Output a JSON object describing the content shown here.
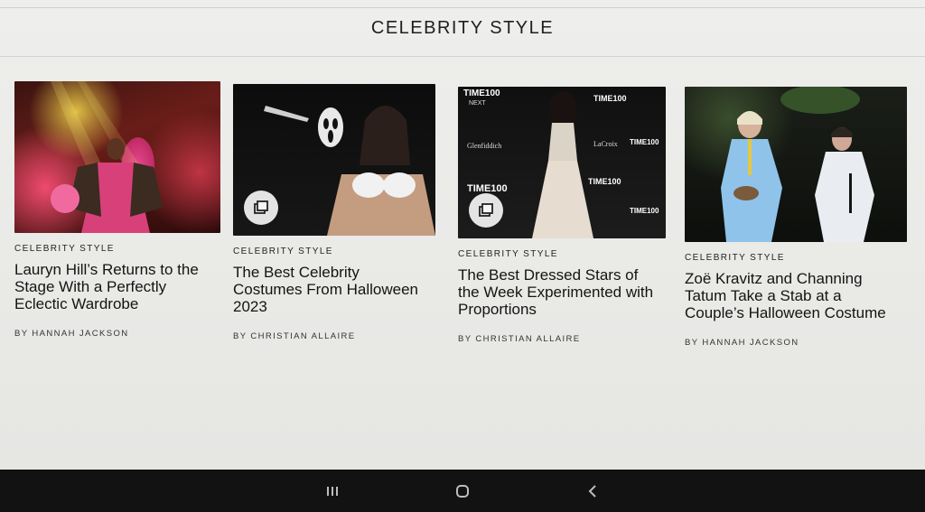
{
  "section": {
    "title": "CELEBRITY STYLE"
  },
  "cards": [
    {
      "kicker": "CELEBRITY STYLE",
      "headline": "Lauryn Hill’s Returns to the Stage With a Perfectly Eclectic Wardrobe",
      "byline": "BY HANNAH JACKSON",
      "has_gallery_icon": false
    },
    {
      "kicker": "CELEBRITY STYLE",
      "headline": "The Best Celebrity Costumes From Halloween 2023",
      "byline": "BY CHRISTIAN ALLAIRE",
      "has_gallery_icon": true
    },
    {
      "kicker": "CELEBRITY STYLE",
      "headline": "The Best Dressed Stars of the Week Experimented with Proportions",
      "byline": "BY CHRISTIAN ALLAIRE",
      "has_gallery_icon": true,
      "backdrop_text": [
        "TIME100",
        "NEXT",
        "Glenfiddich",
        "LaCroix"
      ]
    },
    {
      "kicker": "CELEBRITY STYLE",
      "headline": "Zoë Kravitz and Channing Tatum Take a Stab at a Couple’s Halloween Costume",
      "byline": "BY HANNAH JACKSON",
      "has_gallery_icon": false
    }
  ],
  "icons": {
    "gallery": "gallery-stack-icon",
    "nav_recents": "recent-apps-icon",
    "nav_home": "home-icon",
    "nav_back": "back-icon"
  }
}
